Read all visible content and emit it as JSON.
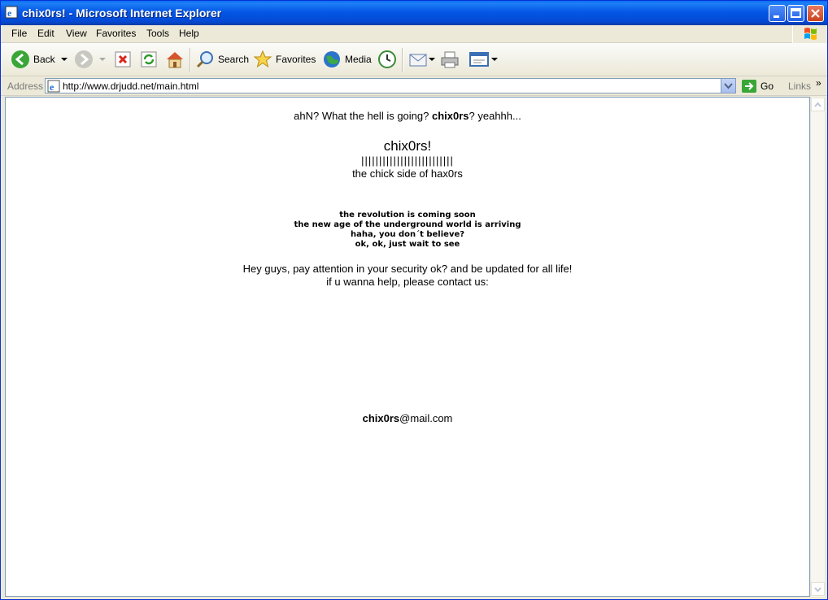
{
  "window": {
    "title": "chix0rs! - Microsoft Internet Explorer"
  },
  "menu": {
    "file": "File",
    "edit": "Edit",
    "view": "View",
    "favorites": "Favorites",
    "tools": "Tools",
    "help": "Help"
  },
  "toolbar": {
    "back": "Back",
    "search": "Search",
    "favorites": "Favorites",
    "media": "Media"
  },
  "address": {
    "label": "Address",
    "url": "http://www.drjudd.net/main.html",
    "go": "Go",
    "links": "Links",
    "links_chevron": "»"
  },
  "page": {
    "line1_a": "ahN? What the hell is going? ",
    "line1_b": "chix0rs",
    "line1_c": "? yeahhh...",
    "title": "chix0rs!",
    "bars": "||||||||||||||||||||||||||",
    "subtitle": "the chick side of hax0rs",
    "bold_lines": [
      "the revolution is coming soon",
      "the new age of the underground world is arriving",
      "haha, you don´t believe?",
      "ok, ok, just wait to see"
    ],
    "hey_line": "Hey guys, pay attention in your security ok? and be updated for all life!",
    "help_line": "if u wanna help, please contact us:",
    "email_bold": "chix0rs",
    "email_rest": "@mail.com"
  },
  "colors": {
    "titlebar": "#0557e6",
    "chrome": "#ece9d8",
    "content_bg": "#ffffff"
  }
}
